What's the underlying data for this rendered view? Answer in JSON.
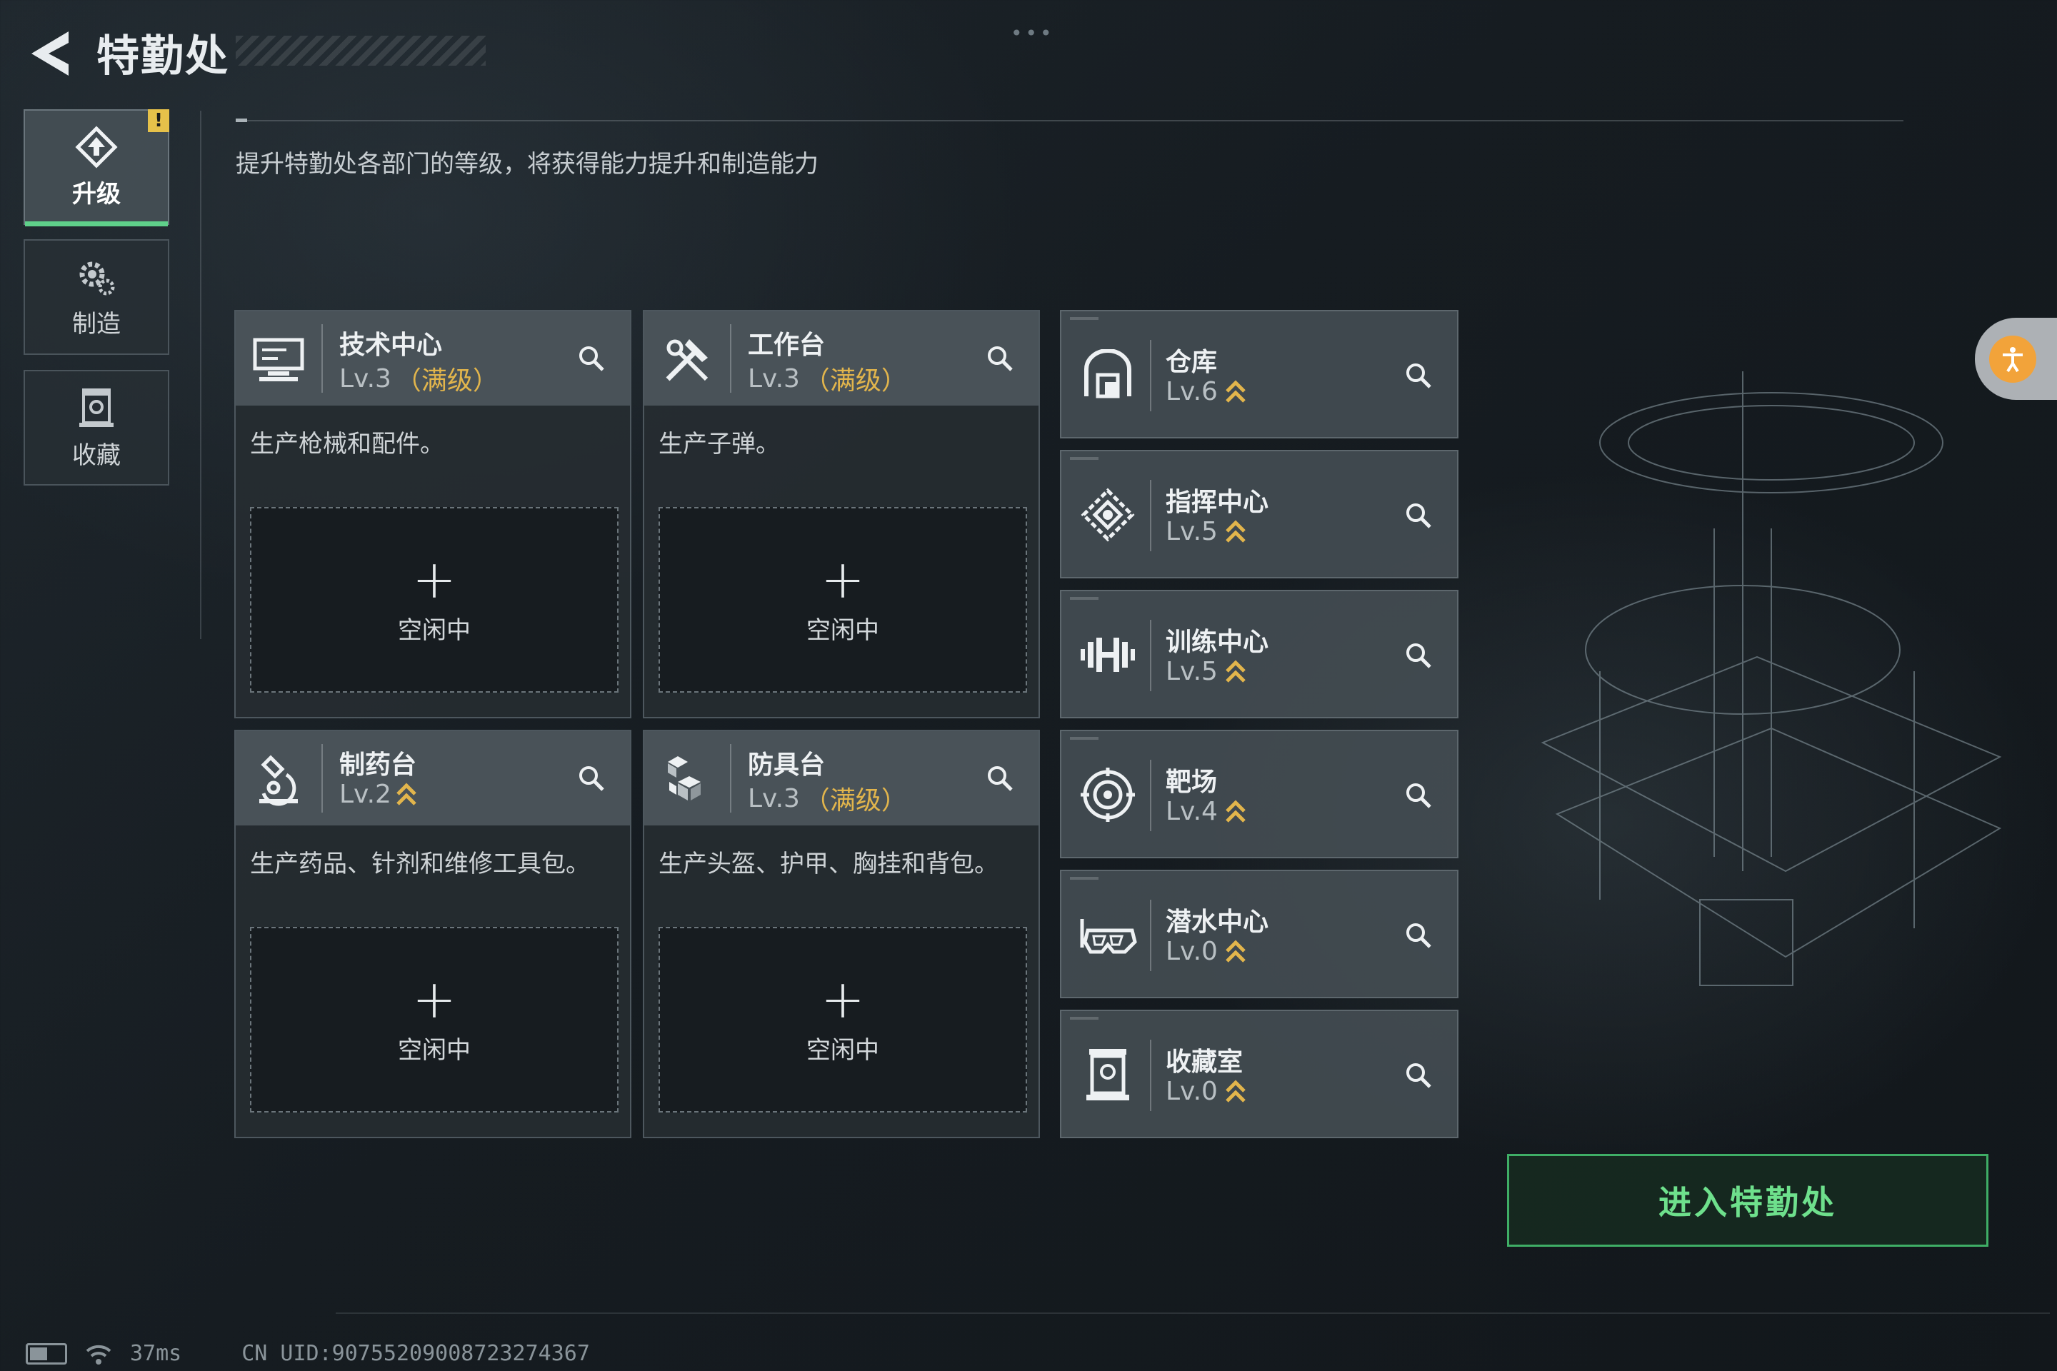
{
  "header": {
    "title": "特勤处",
    "back_icon": "back-arrow-icon",
    "more_indicator": "•••"
  },
  "tabs": [
    {
      "label": "升级",
      "icon": "upgrade-icon",
      "active": true,
      "badge": "!"
    },
    {
      "label": "制造",
      "icon": "gears-icon",
      "active": false
    },
    {
      "label": "收藏",
      "icon": "collection-icon",
      "active": false
    }
  ],
  "description": "提升特勤处各部门的等级，将获得能力提升和制造能力",
  "production_cards": [
    {
      "name": "技术中心",
      "level": "Lv.3",
      "max_tag": "（满级）",
      "desc": "生产枪械和配件。",
      "slot": {
        "plus": "+",
        "status": "空闲中"
      },
      "icon": "computer-icon"
    },
    {
      "name": "工作台",
      "level": "Lv.3",
      "max_tag": "（满级）",
      "desc": "生产子弹。",
      "slot": {
        "plus": "+",
        "status": "空闲中"
      },
      "icon": "tools-icon"
    },
    {
      "name": "制药台",
      "level": "Lv.2",
      "max_tag": "",
      "desc": "生产药品、针剂和维修工具包。",
      "slot": {
        "plus": "+",
        "status": "空闲中"
      },
      "icon": "microscope-icon"
    },
    {
      "name": "防具台",
      "level": "Lv.3",
      "max_tag": "（满级）",
      "desc": "生产头盔、护甲、胸挂和背包。",
      "slot": {
        "plus": "+",
        "status": "空闲中"
      },
      "icon": "armor-blocks-icon"
    }
  ],
  "facilities": [
    {
      "name": "仓库",
      "level": "Lv.6",
      "icon": "warehouse-icon"
    },
    {
      "name": "指挥中心",
      "level": "Lv.5",
      "icon": "command-icon"
    },
    {
      "name": "训练中心",
      "level": "Lv.5",
      "icon": "dumbbell-icon"
    },
    {
      "name": "靶场",
      "level": "Lv.4",
      "icon": "target-icon"
    },
    {
      "name": "潜水中心",
      "level": "Lv.0",
      "icon": "diving-mask-icon"
    },
    {
      "name": "收藏室",
      "level": "Lv.0",
      "icon": "display-case-icon"
    }
  ],
  "enter_button": {
    "label": "进入特勤处"
  },
  "footer": {
    "ping": "37ms",
    "uid": "CN UID:9075520900872327436​7"
  },
  "colors": {
    "accent_green": "#5fd08a",
    "max_level_gold": "#e2b54c",
    "upgrade_arrow": "#e2b54c",
    "warning": "#e6c14a"
  }
}
